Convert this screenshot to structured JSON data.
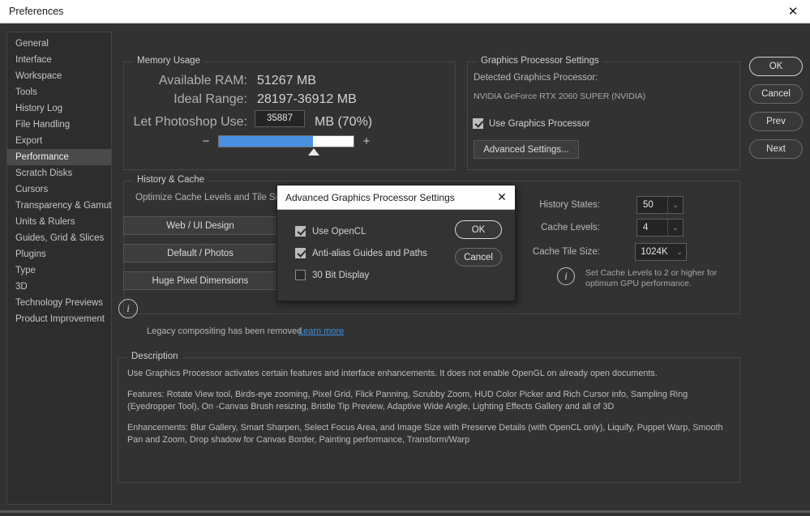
{
  "window": {
    "title": "Preferences",
    "close_label": "✕"
  },
  "sidebar": {
    "items": [
      {
        "label": "General"
      },
      {
        "label": "Interface"
      },
      {
        "label": "Workspace"
      },
      {
        "label": "Tools"
      },
      {
        "label": "History Log"
      },
      {
        "label": "File Handling"
      },
      {
        "label": "Export"
      },
      {
        "label": "Performance"
      },
      {
        "label": "Scratch Disks"
      },
      {
        "label": "Cursors"
      },
      {
        "label": "Transparency & Gamut"
      },
      {
        "label": "Units & Rulers"
      },
      {
        "label": "Guides, Grid & Slices"
      },
      {
        "label": "Plugins"
      },
      {
        "label": "Type"
      },
      {
        "label": "3D"
      },
      {
        "label": "Technology Previews"
      },
      {
        "label": "Product Improvement"
      }
    ],
    "selected": "Performance"
  },
  "memory_usage": {
    "title": "Memory Usage",
    "available_ram_label": "Available RAM:",
    "available_ram_value": "51267 MB",
    "ideal_range_label": "Ideal Range:",
    "ideal_range_value": "28197-36912 MB",
    "let_use_label": "Let Photoshop Use:",
    "let_use_value": "35887",
    "let_use_suffix": "MB (70%)",
    "slider_percent": 70,
    "minus_label": "−",
    "plus_label": "+"
  },
  "graphics": {
    "title": "Graphics Processor Settings",
    "detected_label": "Detected Graphics Processor:",
    "detected_name": "NVIDIA GeForce RTX 2060 SUPER (NVIDIA)",
    "use_gpu_label": "Use Graphics Processor",
    "use_gpu_checked": true,
    "advanced_button": "Advanced Settings..."
  },
  "history_cache": {
    "title": "History & Cache",
    "optimize_hint": "Optimize Cache Levels and Tile Size for:",
    "preset_web": "Web / UI Design",
    "preset_default": "Default / Photos",
    "preset_huge": "Huge Pixel Dimensions",
    "history_states_label": "History States:",
    "history_states_value": "50",
    "cache_levels_label": "Cache Levels:",
    "cache_levels_value": "4",
    "cache_tile_label": "Cache Tile Size:",
    "cache_tile_value": "1024K",
    "info_line1": "Set Cache Levels to 2 or higher for",
    "info_line2": "optimum GPU performance.",
    "info_glyph": "i",
    "arrow_glyph": "⌄"
  },
  "notice": {
    "glyph": "i",
    "text": "Legacy compositing has been removed",
    "link": "Learn more"
  },
  "description": {
    "title": "Description",
    "paragraphs": [
      "Use Graphics Processor activates certain features and interface enhancements. It does not enable OpenGL on already open documents.",
      "Features: Rotate View tool, Birds-eye zooming, Pixel Grid, Flick Panning, Scrubby Zoom, HUD Color Picker and Rich Cursor info, Sampling Ring (Eyedropper Tool), On -Canvas Brush resizing, Bristle Tip Preview, Adaptive Wide Angle, Lighting Effects Gallery and all of 3D",
      "Enhancements: Blur Gallery, Smart Sharpen, Select Focus Area, and Image Size with Preserve Details (with OpenCL only), Liquify, Puppet Warp, Smooth Pan and Zoom, Drop shadow for Canvas Border, Painting performance, Transform/Warp"
    ]
  },
  "actions": {
    "ok": "OK",
    "cancel": "Cancel",
    "prev": "Prev",
    "next": "Next"
  },
  "modal": {
    "title": "Advanced Graphics Processor Settings",
    "close_label": "✕",
    "checkboxes": [
      {
        "label": "Use OpenCL",
        "checked": true
      },
      {
        "label": "Anti-alias Guides and Paths",
        "checked": true
      },
      {
        "label": "30 Bit Display",
        "checked": false
      }
    ],
    "ok": "OK",
    "cancel": "Cancel"
  },
  "colors": {
    "accent_blue": "#4a90e2",
    "link_blue": "#3a8fe0",
    "panel_bg": "#323232",
    "sidebar_bg": "#2d2d2d",
    "selected_bg": "#4a4a4a"
  }
}
